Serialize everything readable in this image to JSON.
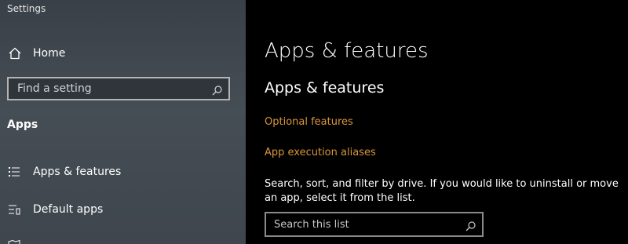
{
  "window": {
    "title": "Settings"
  },
  "sidebar": {
    "home_label": "Home",
    "search": {
      "placeholder": "Find a setting"
    },
    "section_label": "Apps",
    "items": [
      {
        "label": "Apps & features",
        "icon": "apps-features-list-icon"
      },
      {
        "label": "Default apps",
        "icon": "default-apps-list-icon"
      },
      {
        "label": "",
        "icon": "offline-maps-icon"
      }
    ]
  },
  "main": {
    "title": "Apps & features",
    "subtitle": "Apps & features",
    "links": [
      "Optional features",
      "App execution aliases"
    ],
    "description": "Search, sort, and filter by drive. If you would like to uninstall or move an app, select it from the list.",
    "search": {
      "placeholder": "Search this list"
    }
  },
  "colors": {
    "sidebar_bg": "#454d55",
    "main_bg": "#000000",
    "link": "#d9953a",
    "text": "#ffffff"
  }
}
